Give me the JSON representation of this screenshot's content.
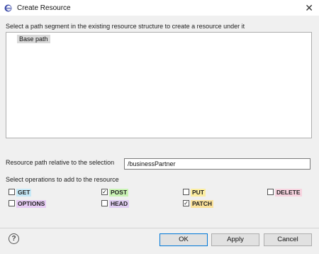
{
  "window": {
    "title": "Create Resource",
    "close_glyph": "✕"
  },
  "tree": {
    "instruction": "Select a path segment in the existing resource structure to create a resource under it",
    "root_label": "Base path"
  },
  "path": {
    "label": "Resource path relative to the selection",
    "value": "/businessPartner"
  },
  "operations": {
    "label": "Select operations to add to the resource",
    "items": [
      {
        "name": "GET",
        "checked": false,
        "color": "#c6e9f7"
      },
      {
        "name": "POST",
        "checked": true,
        "color": "#c9f2b4"
      },
      {
        "name": "PUT",
        "checked": false,
        "color": "#fbeda1"
      },
      {
        "name": "DELETE",
        "checked": false,
        "color": "#f7d3df"
      },
      {
        "name": "OPTIONS",
        "checked": false,
        "color": "#e7ccf5"
      },
      {
        "name": "HEAD",
        "checked": false,
        "color": "#e1cef3"
      },
      {
        "name": "PATCH",
        "checked": true,
        "color": "#fbe29b"
      }
    ]
  },
  "footer": {
    "help_glyph": "?",
    "ok_label": "OK",
    "apply_label": "Apply",
    "cancel_label": "Cancel"
  },
  "icons": {
    "app_icon": "eclipse-icon",
    "help_icon": "help-icon",
    "close_icon": "close-icon"
  },
  "colors": {
    "default_button_border": "#0078d7",
    "tree_selection": "#d9d9d9"
  }
}
